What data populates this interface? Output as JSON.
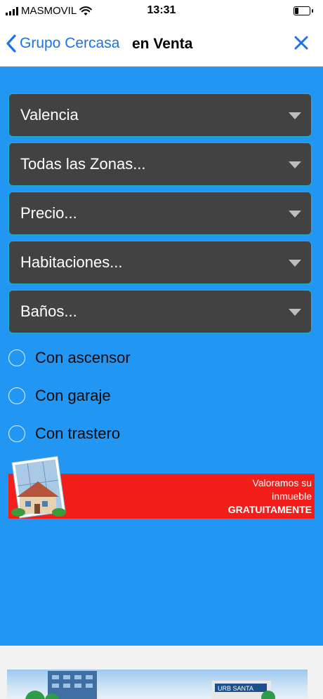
{
  "status_bar": {
    "carrier": "MASMOVIL",
    "time": "13:31"
  },
  "nav": {
    "back_label": "Grupo Cercasa",
    "title": "en Venta"
  },
  "filters": [
    {
      "label": "Valencia"
    },
    {
      "label": "Todas las Zonas..."
    },
    {
      "label": "Precio..."
    },
    {
      "label": "Habitaciones..."
    },
    {
      "label": "Baños..."
    }
  ],
  "options": [
    {
      "label": "Con ascensor"
    },
    {
      "label": "Con garaje"
    },
    {
      "label": "Con trastero"
    }
  ],
  "banner": {
    "line1": "Valoramos su",
    "line2": "inmueble",
    "line3": "GRATUITAMENTE"
  },
  "bottom_image": {
    "sign_text": "URB SANTA"
  },
  "colors": {
    "accent": "#1a73e8",
    "panel": "#2196f3",
    "select_bg": "#424242",
    "select_border": "#1fb2c9",
    "banner": "#f31e1a"
  }
}
